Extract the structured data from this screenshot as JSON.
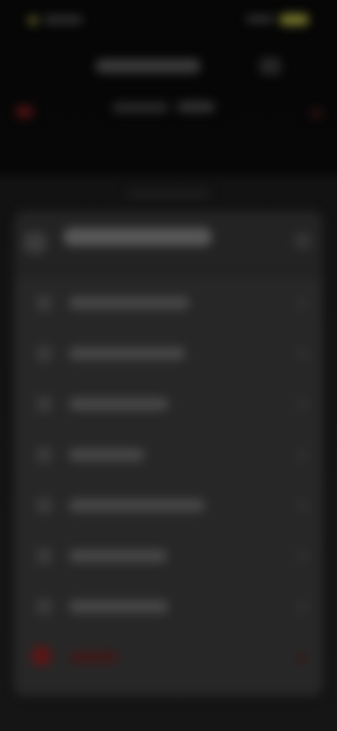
{
  "status_bar": {
    "time": "",
    "battery_color": "#77762c"
  },
  "header": {
    "title": "",
    "subtitle_left": "",
    "subtitle_right": ""
  },
  "sheet": {
    "title": "",
    "items": [
      {
        "label": "",
        "icon": "menu-icon"
      },
      {
        "label": "",
        "icon": "menu-icon"
      },
      {
        "label": "",
        "icon": "menu-icon"
      },
      {
        "label": "",
        "icon": "menu-icon"
      },
      {
        "label": "",
        "icon": "menu-icon"
      },
      {
        "label": "",
        "icon": "menu-icon"
      },
      {
        "label": "",
        "icon": "menu-icon"
      },
      {
        "label": "",
        "icon": "danger-icon"
      }
    ]
  },
  "colors": {
    "background": "#050505",
    "sheet": "#222222",
    "danger": "#5a1616",
    "accent": "#77762c"
  }
}
